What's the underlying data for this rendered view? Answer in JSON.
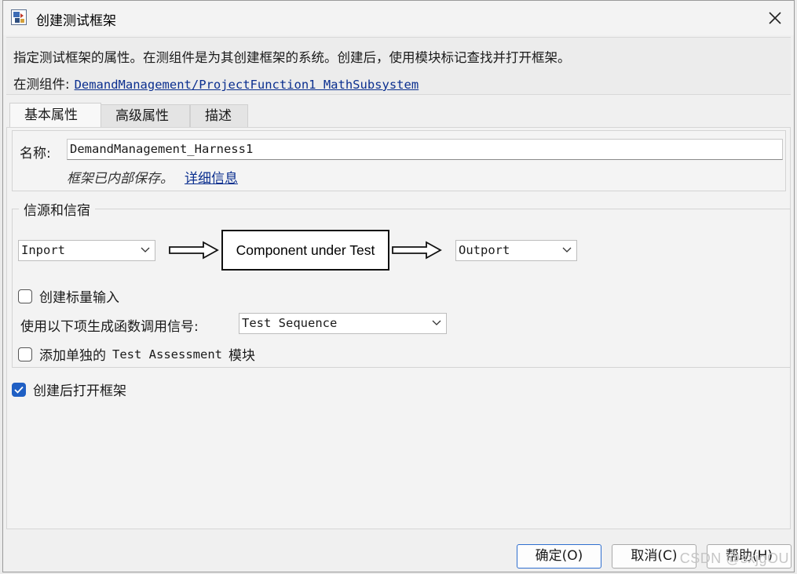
{
  "window": {
    "title": "创建测试框架"
  },
  "description": {
    "text": "指定测试框架的属性。在测组件是为其创建框架的系统。创建后，使用模块标记查找并打开框架。",
    "component_label": "在测组件:",
    "component_link": "DemandManagement/ProjectFunction1 MathSubsystem"
  },
  "tabs": [
    {
      "label": "基本属性",
      "active": true
    },
    {
      "label": "高级属性",
      "active": false
    },
    {
      "label": "描述",
      "active": false
    }
  ],
  "name_section": {
    "label": "名称:",
    "value": "DemandManagement_Harness1",
    "note": "框架已内部保存。",
    "details_link": "详细信息"
  },
  "sources_sinks": {
    "legend": "信源和信宿",
    "source": "Inport",
    "component": "Component under Test",
    "sink": "Outport",
    "scalar_inputs_label": "创建标量输入",
    "scalar_inputs_checked": false,
    "function_call_label": "使用以下项生成函数调用信号:",
    "function_call_value": "Test Sequence",
    "assessment_label_pre": "添加单独的",
    "assessment_label_mono": "Test Assessment",
    "assessment_label_post": "模块",
    "assessment_checked": false
  },
  "open_after_create": {
    "label": "创建后打开框架",
    "checked": true
  },
  "buttons": {
    "ok": "确定(O)",
    "cancel": "取消(C)",
    "help": "帮助(H)"
  },
  "watermark": "CSDN @sxjgOU",
  "colors": {
    "link": "#0b2f8f",
    "accent": "#1f5fc4"
  }
}
